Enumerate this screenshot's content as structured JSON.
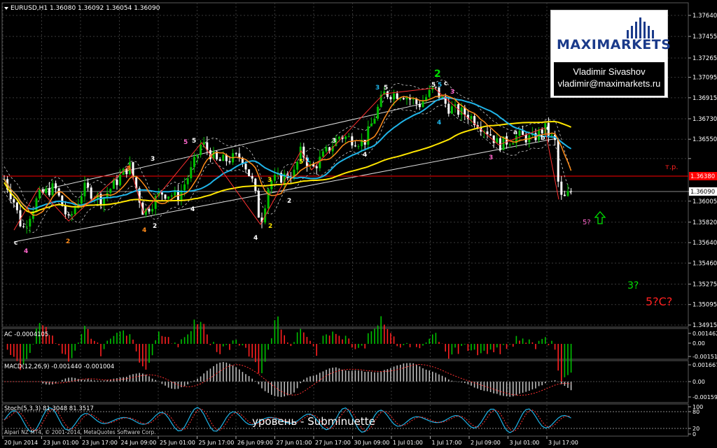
{
  "header": {
    "symbol_line": "EURUSD,H1  1.36080 1.36092 1.36054 1.36090"
  },
  "branding": {
    "logo_text": "MAXIMARKETS",
    "author_name": "Vladimir Sivashov",
    "author_email": "vladimir@maximarkets.ru"
  },
  "caption": "уровень - Subminuette",
  "copyright": "Alpari NZ MT4, © 2001-2014, MetaQuotes Software Corp.",
  "annotations": {
    "tp_label": "т.р.",
    "target_3": "3?",
    "target_5c": "5?C?",
    "target_5_small": "5?"
  },
  "colors": {
    "background": "#000000",
    "bull_candle": "#00c000",
    "bear_candle": "#ffffff",
    "ma_fast": "#ff8c1a",
    "ma_mid": "#1fb4e8",
    "ma_slow": "#ffe600",
    "zigzag": "#ff3030",
    "channel": "#dcdcdc",
    "tp_line": "#ff0000",
    "grid": "#3a3a3a"
  },
  "chart_data": [
    {
      "type": "candlestick",
      "title": "EURUSD,H1",
      "ohlc_current": {
        "open": 1.3608,
        "high": 1.36092,
        "low": 1.36054,
        "close": 1.3609
      },
      "price_axis_ticks": [
        "1.37640",
        "1.37455",
        "1.37265",
        "1.37095",
        "1.36915",
        "1.36730",
        "1.36550",
        "1.36380",
        "1.36090",
        "1.36005",
        "1.35820",
        "1.35640",
        "1.35460",
        "1.35275",
        "1.35095",
        "1.34915"
      ],
      "current_price": "1.36090",
      "tp_price": "1.36380",
      "time_axis_ticks": [
        "20 Jun 2014",
        "23 Jun 01:00",
        "23 Jun 17:00",
        "24 Jun 09:00",
        "25 Jun 01:00",
        "25 Jun 17:00",
        "26 Jun 09:00",
        "27 Jun 01:00",
        "27 Jun 17:00",
        "30 Jun 09:00",
        "1 Jul 01:00",
        "1 Jul 17:00",
        "2 Jul 09:00",
        "3 Jul 01:00",
        "3 Jul 17:00"
      ],
      "wave_labels": [
        {
          "t": "c",
          "color": "#ffffff"
        },
        {
          "t": "4",
          "color": "#ff66cc"
        },
        {
          "t": "2",
          "color": "#ff8c1a"
        },
        {
          "t": "3",
          "color": "#ff8c1a"
        },
        {
          "t": "4",
          "color": "#ff8c1a"
        },
        {
          "t": "2",
          "color": "#ffffff"
        },
        {
          "t": "3",
          "color": "#ffffff"
        },
        {
          "t": "5",
          "color": "#ff66cc"
        },
        {
          "t": "5",
          "color": "#ffffff"
        },
        {
          "t": "4",
          "color": "#ffffff"
        },
        {
          "t": "3",
          "color": "#ffe600"
        },
        {
          "t": "4",
          "color": "#ffffff"
        },
        {
          "t": "2",
          "color": "#ffe600"
        },
        {
          "t": "5",
          "color": "#ffe600"
        },
        {
          "t": "1",
          "color": "#1fb4e8"
        },
        {
          "t": "2",
          "color": "#ffffff"
        },
        {
          "t": "3",
          "color": "#ffffff"
        },
        {
          "t": "4",
          "color": "#ffffff"
        },
        {
          "t": "3",
          "color": "#1fb4e8"
        },
        {
          "t": "5",
          "color": "#ffffff"
        },
        {
          "t": "2",
          "color": "#00e000"
        },
        {
          "t": "5",
          "color": "#ffffff"
        },
        {
          "t": "5",
          "color": "#1fb4e8"
        },
        {
          "t": "c",
          "color": "#ffffff"
        },
        {
          "t": "3",
          "color": "#ff66cc"
        },
        {
          "t": "4",
          "color": "#1fb4e8"
        },
        {
          "t": "a",
          "color": "#ffffff"
        },
        {
          "t": "3",
          "color": "#ff66cc"
        },
        {
          "t": "c",
          "color": "#ffffff"
        },
        {
          "t": "b",
          "color": "#ffffff"
        }
      ]
    },
    {
      "type": "histogram",
      "title": "AC -0.0004105",
      "axis_ticks": [
        "0.001462",
        "0.00",
        "-0.001513"
      ]
    },
    {
      "type": "histogram",
      "title": "MACD(12,26,9) -0.001440 -0.001004",
      "axis_ticks": [
        "0.001667",
        "0.00",
        "-0.001598"
      ]
    },
    {
      "type": "line",
      "title": "Stoch(5,3,3) 81.3048 81.3517",
      "axis_ticks": [
        "100",
        "80",
        "20",
        "0"
      ]
    }
  ]
}
